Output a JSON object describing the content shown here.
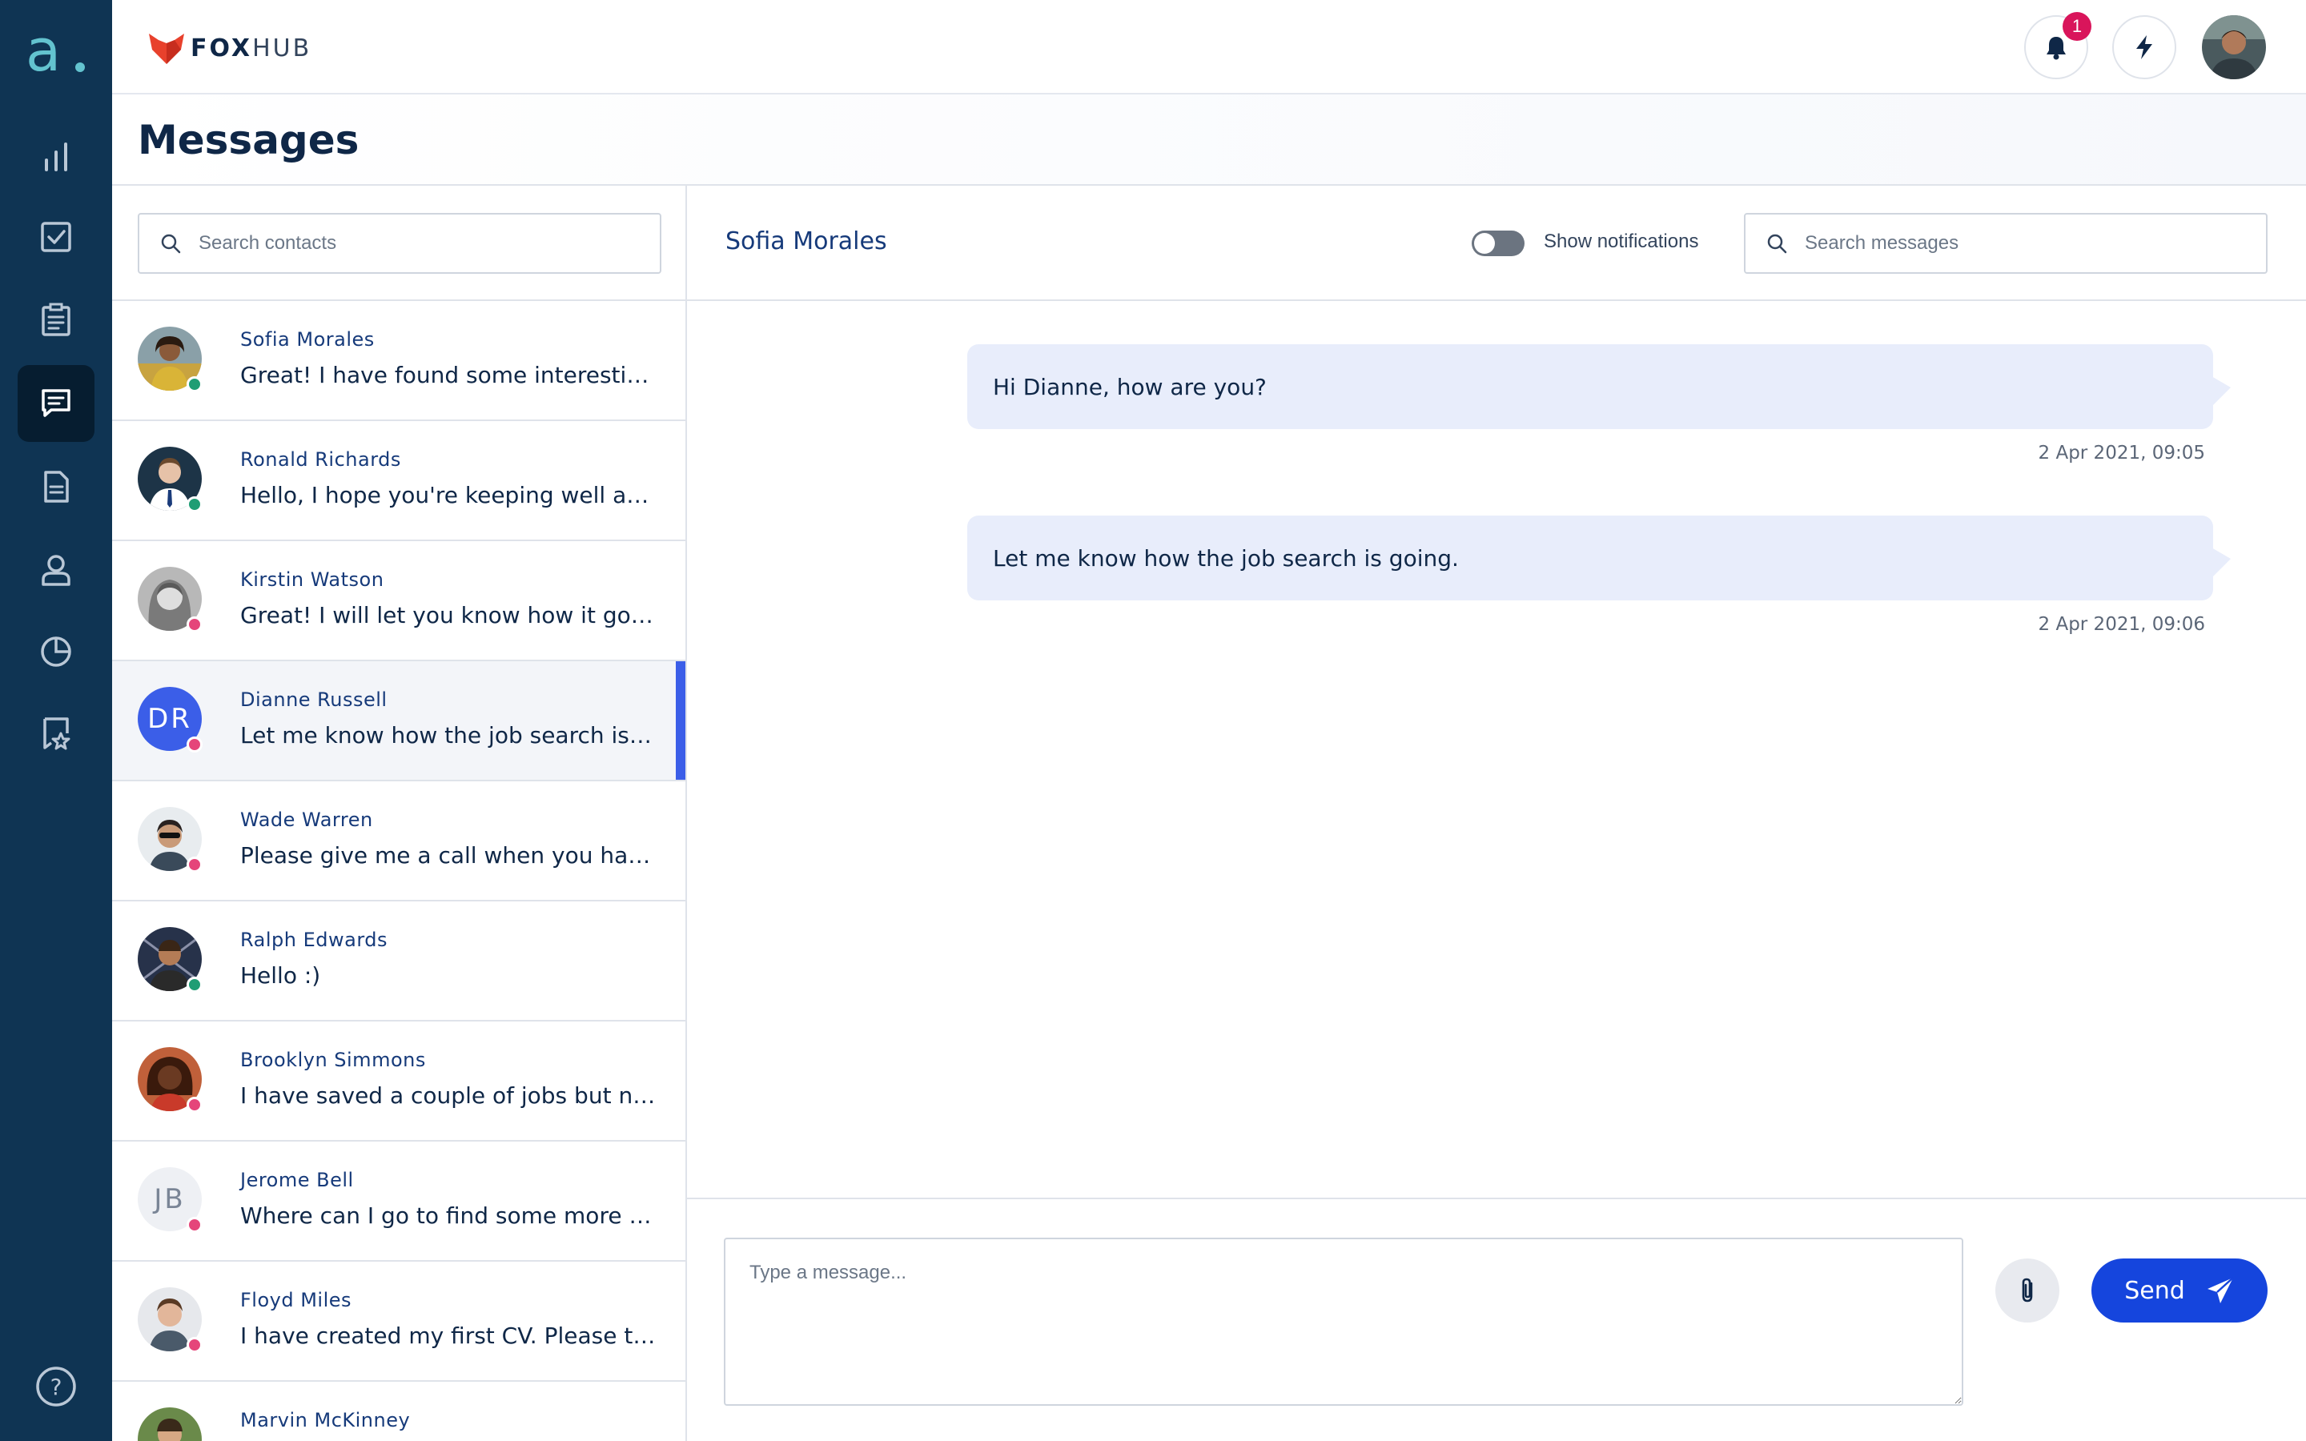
{
  "app": {
    "logo_letter": "a.",
    "brand_bold": "FOX",
    "brand_light": "HUB",
    "page_title": "Messages"
  },
  "header": {
    "notification_count": "1"
  },
  "sidebar": {
    "items": [
      {
        "icon": "bar-chart-icon"
      },
      {
        "icon": "checkbox-icon"
      },
      {
        "icon": "clipboard-icon"
      },
      {
        "icon": "chat-icon",
        "active": true
      },
      {
        "icon": "document-icon"
      },
      {
        "icon": "user-icon"
      },
      {
        "icon": "pie-chart-icon"
      },
      {
        "icon": "bookmark-star-icon"
      }
    ],
    "help_icon": "help-icon"
  },
  "contacts": {
    "search_placeholder": "Search contacts",
    "list": [
      {
        "name": "Sofia Morales",
        "preview": "Great! I have found some interesting eLearning courses I'd like to take.",
        "status": "online",
        "avatar": "photo"
      },
      {
        "name": "Ronald Richards",
        "preview": "Hello, I hope you're keeping well and that everything is fine.",
        "status": "online",
        "avatar": "photo"
      },
      {
        "name": "Kirstin Watson",
        "preview": "Great! I will let you know how it goes later today.",
        "status": "offline",
        "avatar": "photo"
      },
      {
        "name": "Dianne Russell",
        "preview": "Let me know how the job search is going.",
        "status": "offline",
        "avatar": "initials",
        "initials": "DR",
        "active": true
      },
      {
        "name": "Wade Warren",
        "preview": "Please give me a call when you have some time.",
        "status": "offline",
        "avatar": "photo"
      },
      {
        "name": "Ralph Edwards",
        "preview": "Hello :)",
        "status": "online",
        "avatar": "photo"
      },
      {
        "name": "Brooklyn Simmons",
        "preview": "I have saved a couple of jobs but need some advice.",
        "status": "offline",
        "avatar": "photo"
      },
      {
        "name": "Jerome Bell",
        "preview": "Where can I go to find some more info about it?",
        "status": "offline",
        "avatar": "initials",
        "initials": "JB"
      },
      {
        "name": "Floyd Miles",
        "preview": "I have created my first CV. Please take a look.",
        "status": "offline",
        "avatar": "photo"
      },
      {
        "name": "Marvin McKinney",
        "preview": "",
        "status": "online",
        "avatar": "photo"
      }
    ]
  },
  "chat": {
    "title": "Sofia Morales",
    "toggle_label": "Show notifications",
    "search_placeholder": "Search messages",
    "messages": [
      {
        "text": "Hi Dianne, how are you?",
        "time": "2 Apr 2021, 09:05"
      },
      {
        "text": "Let me know how the job search is going.",
        "time": "2 Apr 2021, 09:06"
      }
    ],
    "compose_placeholder": "Type a message...",
    "send_label": "Send"
  },
  "colors": {
    "rail": "#0f3453",
    "accent": "#1545dd",
    "online": "#1f9d74",
    "offline": "#e5457a",
    "badge": "#d9155b"
  }
}
